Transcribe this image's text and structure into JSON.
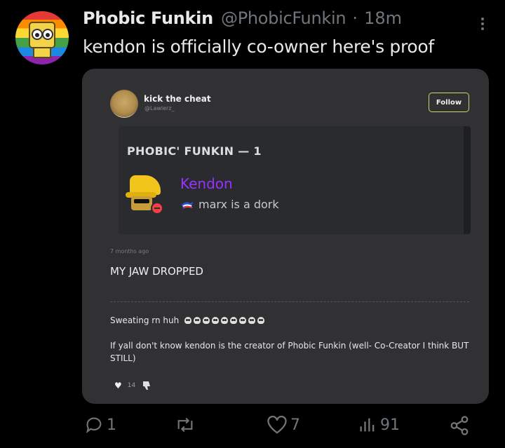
{
  "tweet": {
    "display_name": "Phobic Funkin",
    "handle": "@PhobicFunkin",
    "separator": "·",
    "time": "18m",
    "text": "kendon is officially co-owner here's proof"
  },
  "embedded_post": {
    "username": "kick the cheat",
    "handle": "@Lawlerz_",
    "follow_label": "Follow",
    "discord_embed": {
      "server_title": "PHOBIC' FUNKIN — 1",
      "member_name": "Kendon",
      "member_name_color": "#9b30ff",
      "status_text": "marx is a dork",
      "presence": "do-not-disturb"
    },
    "timestamp": "7 months ago",
    "caption": "MY JAW DROPPED",
    "reply_1": "Sweating rn huh",
    "reply_1_emoji": [
      "skull-icon",
      "skull-icon",
      "skull-icon",
      "skull-icon",
      "skull-icon",
      "skull-icon",
      "skull-icon",
      "skull-icon",
      "skull-icon"
    ],
    "reply_2": "If yall don't know kendon is the creator of Phobic Funkin (well- Co-Creator I think BUT STILL)",
    "like_count": "14"
  },
  "actions": {
    "replies": "1",
    "retweets": "",
    "likes": "7",
    "views": "91"
  },
  "colors": {
    "background": "#000000",
    "card": "#313134",
    "text": "#e7e9ea",
    "muted": "#71767b",
    "follow_border": "#c8d86a"
  }
}
